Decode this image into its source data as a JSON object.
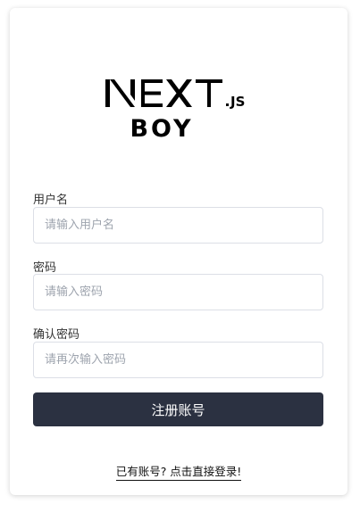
{
  "logo": {
    "brand_text": "NEXT.JS",
    "sub_text": "BOY"
  },
  "form": {
    "username": {
      "label": "用户名",
      "placeholder": "请输入用户名",
      "value": ""
    },
    "password": {
      "label": "密码",
      "placeholder": "请输入密码",
      "value": ""
    },
    "confirm_password": {
      "label": "确认密码",
      "placeholder": "请再次输入密码",
      "value": ""
    },
    "submit_label": "注册账号"
  },
  "footer": {
    "login_link_label": "已有账号? 点击直接登录!"
  },
  "colors": {
    "button_bg": "#2b3141",
    "button_text": "#ffffff",
    "input_border": "#dcdfe6",
    "placeholder": "#9ea4ae"
  }
}
